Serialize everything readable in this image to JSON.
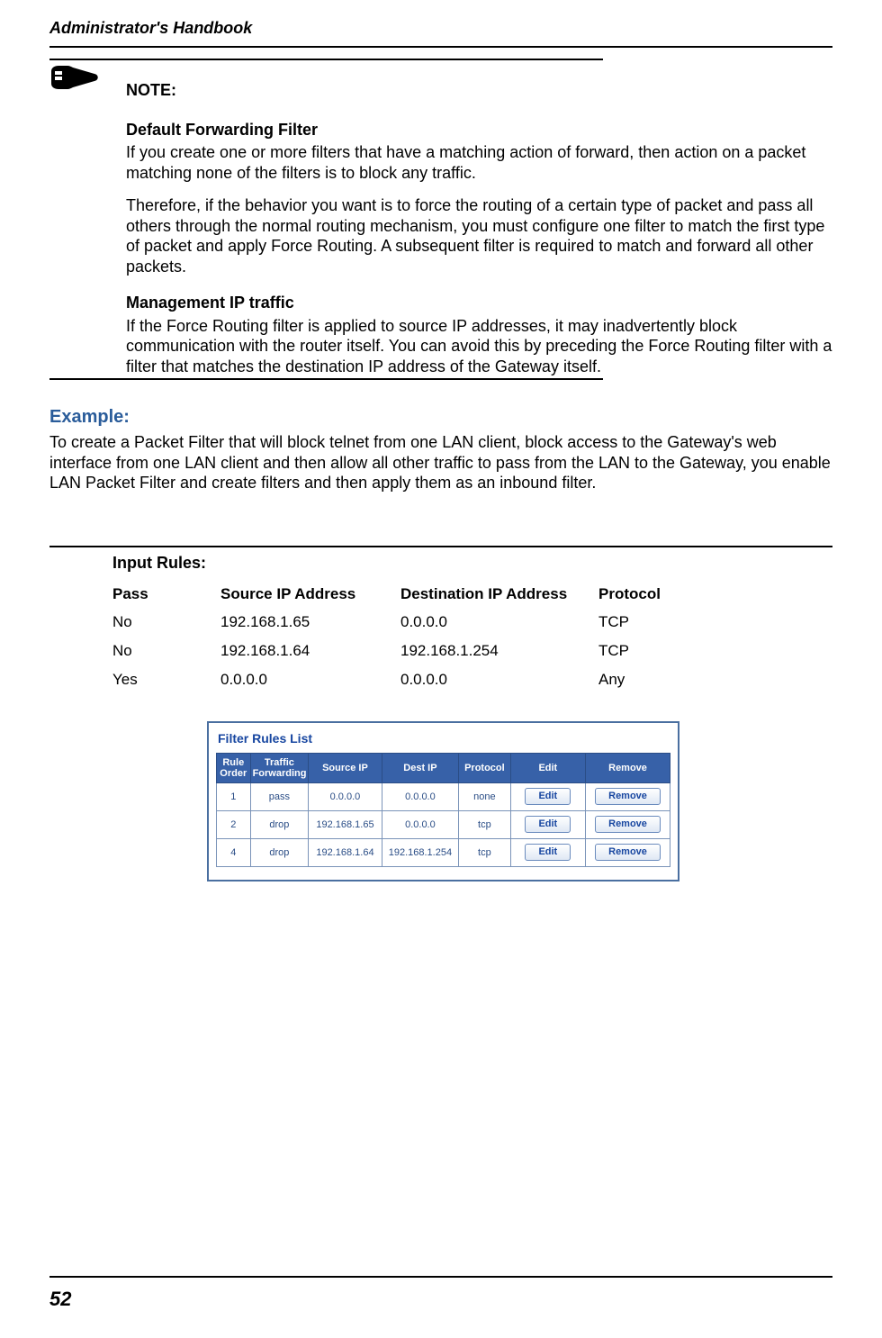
{
  "header": {
    "title": "Administrator's Handbook"
  },
  "note": {
    "label": "NOTE:",
    "sub1_title": "Default Forwarding Filter",
    "sub1_p1": "If you create one or more filters that have a matching action of forward, then action on a packet matching none of the filters is to block any traffic.",
    "sub1_p2": "Therefore, if the behavior you want is to force the routing of a certain type of packet and pass all others through the normal routing mechanism, you must configure one filter to match the first type of packet and apply Force Routing. A subsequent filter is required to match and forward all other packets.",
    "sub2_title": "Management IP traffic",
    "sub2_p1": "If the Force Routing filter is applied to source IP addresses, it may inadvertently block communication with the router itself. You can avoid this by preceding the Force Routing filter with a filter that matches the destination IP address of the Gateway itself."
  },
  "example": {
    "title": "Example:",
    "body": "To create a Packet Filter that will block telnet from one LAN client, block access to the Gateway's web interface from one LAN client and then allow all other traffic to pass from the LAN to the Gateway, you enable LAN Packet Filter and create filters and then apply them as an inbound filter."
  },
  "input_rules": {
    "title": "Input Rules:",
    "headers": {
      "pass": "Pass",
      "src": "Source IP Address",
      "dst": "Destination IP Address",
      "prot": "Protocol"
    },
    "rows": [
      {
        "pass": "No",
        "src": "192.168.1.65",
        "dst": "0.0.0.0",
        "prot": "TCP"
      },
      {
        "pass": "No",
        "src": "192.168.1.64",
        "dst": "192.168.1.254",
        "prot": "TCP"
      },
      {
        "pass": "Yes",
        "src": "0.0.0.0",
        "dst": "0.0.0.0",
        "prot": "Any"
      }
    ]
  },
  "filter_rules": {
    "title": "Filter Rules List",
    "headers": {
      "order": "Rule Order",
      "fwd": "Traffic Forwarding",
      "src": "Source IP",
      "dst": "Dest IP",
      "prot": "Protocol",
      "edit": "Edit",
      "remove": "Remove"
    },
    "rows": [
      {
        "order": "1",
        "fwd": "pass",
        "src": "0.0.0.0",
        "dst": "0.0.0.0",
        "prot": "none",
        "edit": "Edit",
        "remove": "Remove"
      },
      {
        "order": "2",
        "fwd": "drop",
        "src": "192.168.1.65",
        "dst": "0.0.0.0",
        "prot": "tcp",
        "edit": "Edit",
        "remove": "Remove"
      },
      {
        "order": "4",
        "fwd": "drop",
        "src": "192.168.1.64",
        "dst": "192.168.1.254",
        "prot": "tcp",
        "edit": "Edit",
        "remove": "Remove"
      }
    ]
  },
  "page_number": "52"
}
